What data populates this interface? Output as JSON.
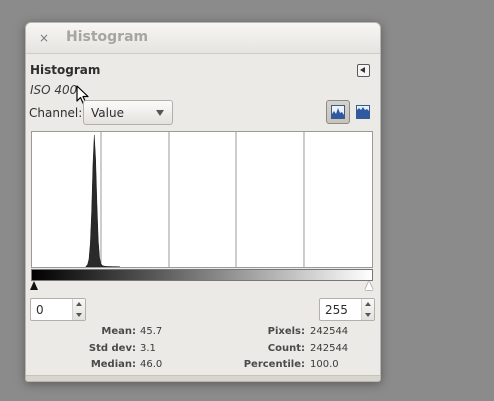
{
  "window": {
    "title": "Histogram",
    "close_glyph": "×"
  },
  "dock": {
    "title": "Histogram",
    "image_name": "ISO 400"
  },
  "channel": {
    "label": "Channel:",
    "selected": "Value"
  },
  "icons": {
    "close": "close-icon",
    "menu": "dock-menu-icon",
    "linear": "linear-histogram-icon",
    "log": "logarithmic-histogram-icon"
  },
  "range": {
    "low": "0",
    "high": "255"
  },
  "stats": {
    "mean_label": "Mean:",
    "mean_value": "45.7",
    "std_label": "Std dev:",
    "std_value": "3.1",
    "median_label": "Median:",
    "median_value": "46.0",
    "pixels_label": "Pixels:",
    "pixels_value": "242544",
    "count_label": "Count:",
    "count_value": "242544",
    "percentile_label": "Percentile:",
    "percentile_value": "100.0"
  },
  "histogram": {
    "x_min": 0,
    "x_max": 255,
    "bins": [
      [
        40,
        0.008
      ],
      [
        41,
        0.02
      ],
      [
        42,
        0.06
      ],
      [
        43,
        0.18
      ],
      [
        44,
        0.42
      ],
      [
        45,
        0.78
      ],
      [
        46,
        1.0
      ],
      [
        47,
        0.82
      ],
      [
        48,
        0.48
      ],
      [
        49,
        0.2
      ],
      [
        50,
        0.07
      ],
      [
        51,
        0.025
      ],
      [
        52,
        0.012
      ],
      [
        53,
        0.008
      ],
      [
        54,
        0.006
      ],
      [
        55,
        0.005
      ],
      [
        56,
        0.004
      ],
      [
        58,
        0.004
      ],
      [
        60,
        0.003
      ],
      [
        62,
        0.003
      ],
      [
        65,
        0.002
      ]
    ]
  },
  "colors": {
    "background": "#8b8b8b",
    "panel": "#eceae6",
    "histogram_fill": "#2a2a2a"
  }
}
